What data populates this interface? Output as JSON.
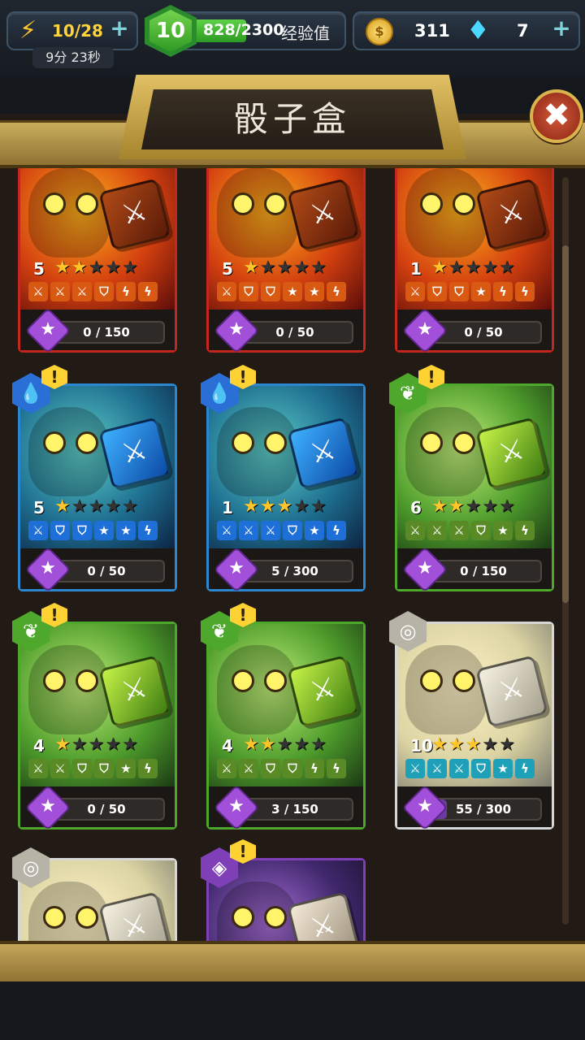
{
  "header": {
    "energy": {
      "value": "10/28",
      "icon": "lightning-icon"
    },
    "timer": {
      "minutes": "9",
      "min_unit": "分",
      "seconds": "23",
      "sec_unit": "秒"
    },
    "level": "10",
    "xp": {
      "value": "828/2300",
      "label": "经验值",
      "progress": 0.36
    },
    "gold": "311",
    "gems": "7"
  },
  "title": "骰子盒",
  "close_icon": "✖",
  "cards": [
    {
      "element": "fire",
      "level": "5",
      "stars": 2,
      "progress": "0 / 150",
      "fill": 0.0,
      "alert": false,
      "faces": [
        "⚔",
        "⚔",
        "⚔",
        "⛉",
        "ϟ",
        "ϟ"
      ]
    },
    {
      "element": "fire",
      "level": "5",
      "stars": 1,
      "progress": "0 / 50",
      "fill": 0.0,
      "alert": false,
      "faces": [
        "⚔",
        "⛉",
        "⛉",
        "★",
        "★",
        "ϟ"
      ]
    },
    {
      "element": "fire",
      "level": "1",
      "stars": 1,
      "progress": "0 / 50",
      "fill": 0.0,
      "alert": false,
      "faces": [
        "⚔",
        "⛉",
        "⛉",
        "★",
        "ϟ",
        "ϟ"
      ]
    },
    {
      "element": "water",
      "level": "5",
      "stars": 1,
      "progress": "0 / 50",
      "fill": 0.0,
      "alert": true,
      "faces": [
        "⚔",
        "⛉",
        "⛉",
        "★",
        "★",
        "ϟ"
      ]
    },
    {
      "element": "water",
      "level": "1",
      "stars": 3,
      "progress": "5 / 300",
      "fill": 0.02,
      "alert": true,
      "faces": [
        "⚔",
        "⚔",
        "⚔",
        "⛉",
        "★",
        "ϟ"
      ]
    },
    {
      "element": "earth",
      "level": "6",
      "stars": 2,
      "progress": "0 / 150",
      "fill": 0.0,
      "alert": true,
      "faces": [
        "⚔",
        "⚔",
        "⚔",
        "⛉",
        "★",
        "ϟ"
      ]
    },
    {
      "element": "earth",
      "level": "4",
      "stars": 1,
      "progress": "0 / 50",
      "fill": 0.0,
      "alert": true,
      "faces": [
        "⚔",
        "⚔",
        "⛉",
        "⛉",
        "★",
        "ϟ"
      ]
    },
    {
      "element": "earth",
      "level": "4",
      "stars": 2,
      "progress": "3 / 150",
      "fill": 0.02,
      "alert": true,
      "faces": [
        "⚔",
        "⚔",
        "⛉",
        "⛉",
        "ϟ",
        "ϟ"
      ]
    },
    {
      "element": "air",
      "level": "10",
      "stars": 3,
      "progress": "55 / 300",
      "fill": 0.18,
      "alert": false,
      "faces": [
        "⚔",
        "⚔",
        "⚔",
        "⛉",
        "★",
        "ϟ"
      ]
    },
    {
      "element": "air",
      "level": "",
      "stars": 0,
      "progress": "",
      "fill": 0.0,
      "alert": false,
      "faces": []
    },
    {
      "element": "void",
      "level": "",
      "stars": 0,
      "progress": "",
      "fill": 0.0,
      "alert": true,
      "faces": []
    }
  ]
}
